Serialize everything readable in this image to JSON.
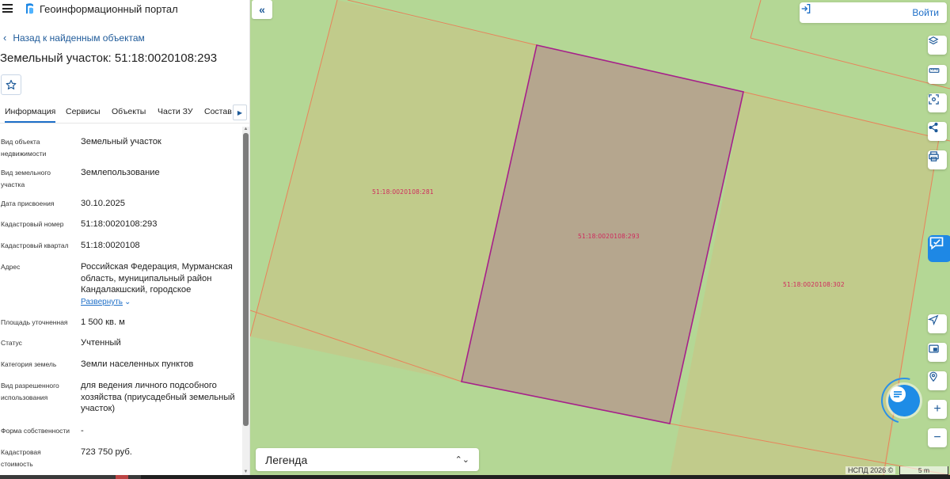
{
  "header": {
    "portal_title": "Геоинформационный портал",
    "menu_icon": "hamburger-menu-icon",
    "logo_icon": "portal-logo-icon"
  },
  "navigation": {
    "back_label": "Назад к найденным объектам"
  },
  "parcel": {
    "title": "Земельный участок: 51:18:0020108:293",
    "favorite_icon": "star-icon"
  },
  "tabs": [
    {
      "label": "Информация",
      "active": true
    },
    {
      "label": "Сервисы",
      "active": false
    },
    {
      "label": "Объекты",
      "active": false
    },
    {
      "label": "Части ЗУ",
      "active": false
    },
    {
      "label": "Состав",
      "active": false
    }
  ],
  "properties": [
    {
      "label": "Вид объекта недвижимости",
      "value": "Земельный участок"
    },
    {
      "label": "Вид земельного участка",
      "value": "Землепользование"
    },
    {
      "label": "Дата присвоения",
      "value": "30.10.2025"
    },
    {
      "label": "Кадастровый номер",
      "value": "51:18:0020108:293"
    },
    {
      "label": "Кадастровый квартал",
      "value": "51:18:0020108"
    },
    {
      "label": "Адрес",
      "value": "Российская Федерация, Мурманская область, муниципальный район Кандалакшский, городское"
    },
    {
      "label": "Площадь уточненная",
      "value": "1 500 кв. м"
    },
    {
      "label": "Статус",
      "value": "Учтенный"
    },
    {
      "label": "Категория земель",
      "value": "Земли населенных пунктов"
    },
    {
      "label": "Вид разрешенного использования",
      "value": "для ведения личного подсобного хозяйства (приусадебный земельный участок)"
    },
    {
      "label": "Форма собственности",
      "value": "-"
    },
    {
      "label": "Кадастровая стоимость",
      "value": "723 750 руб."
    }
  ],
  "expand_label": "Развернуть",
  "map": {
    "login_label": "Войти",
    "legend_label": "Легенда",
    "copyright": "НСПД 2026 ©",
    "scale_label": "5 m",
    "parcel_labels": {
      "left": "51:18:0020108:281",
      "center": "51:18:0020108:293",
      "right": "51:18:0020108:302"
    },
    "colors": {
      "background": "#b4d795",
      "parcel_fill": "#c1cb8b",
      "selected_fill": "#b5a68e",
      "selected_stroke": "#a6208a",
      "boundary": "#e8835a",
      "label": "#d0285c",
      "accent": "#1e6fc8"
    },
    "tools": [
      "layers-icon",
      "ruler-icon",
      "area-select-icon",
      "share-icon",
      "print-icon",
      "locate-icon",
      "minimap-icon",
      "geolocation-icon",
      "zoom-in-icon",
      "zoom-out-icon"
    ]
  }
}
